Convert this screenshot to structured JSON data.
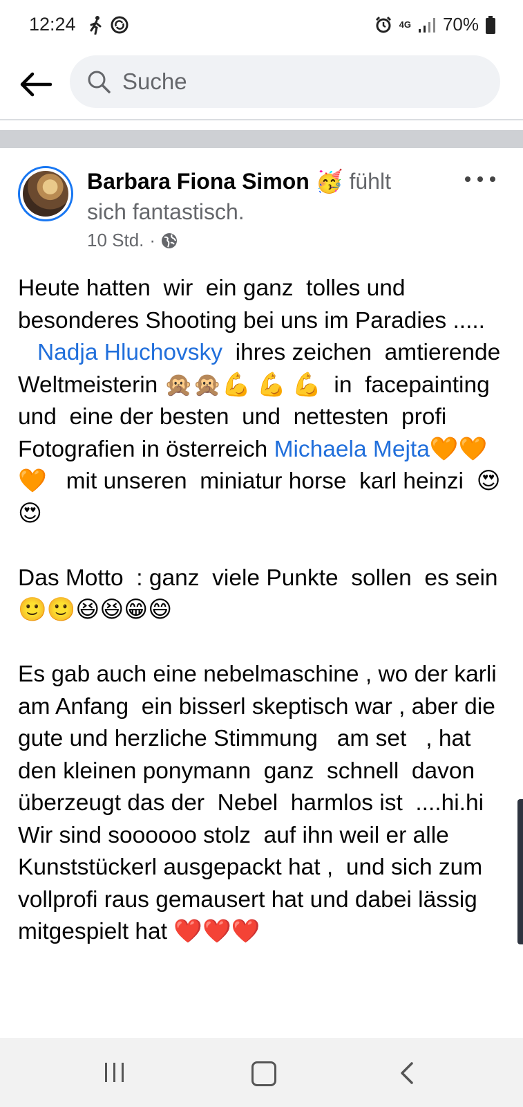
{
  "status_bar": {
    "time": "12:24",
    "battery": "70%",
    "network": "4G"
  },
  "search": {
    "placeholder": "Suche"
  },
  "post": {
    "author": "Barbara Fiona Simon",
    "feeling_emoji": "🥳",
    "feeling_text": " fühlt sich fantastisch.",
    "time": "10 Std.",
    "separator": "·",
    "body": {
      "p1": "Heute hatten  wir  ein ganz  tolles und besonderes Shooting bei uns im Paradies .....",
      "p2_indent": "   ",
      "mention1": "Nadja Hluchovsky",
      "p2_after_mention1": "  ihres zeichen  amtierende  Weltmeisterin 🙊🙊💪 💪 💪  in  facepainting  und  eine der besten  und  nettesten  profi Fotografien in österreich",
      "mention2": "Michaela Mejta",
      "p2_after_mention2": "🧡🧡🧡   mit unseren  miniatur horse  karl heinzi  😍😍",
      "p3": "Das Motto  : ganz  viele Punkte  sollen  es sein 🙂🙂😆😆😁😄",
      "p4": "Es gab auch eine nebelmaschine , wo der karli am Anfang  ein bisserl skeptisch war , aber die gute und herzliche Stimmung   am set   , hat den kleinen ponymann  ganz  schnell  davon überzeugt das der  Nebel  harmlos ist  ....hi.hi",
      "p5": "Wir sind soooooo stolz  auf ihn weil er alle Kunststückerl ausgepackt hat ,  und sich zum vollprofi raus gemausert hat und dabei lässig  mitgespielt hat ❤️❤️❤️"
    }
  },
  "colors": {
    "accent": "#1877f2",
    "mention": "#216fdb",
    "secondary_text": "#65676b",
    "search_bg": "#f0f2f5",
    "divider": "#ced0d4"
  }
}
